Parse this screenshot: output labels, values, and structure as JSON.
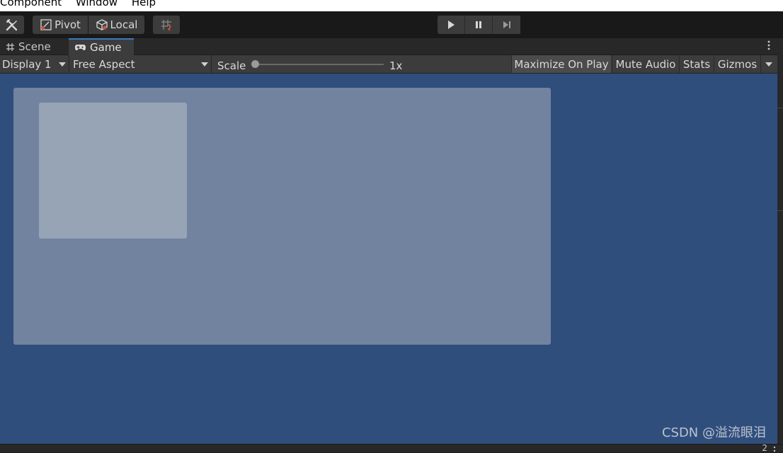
{
  "menubar": {
    "items": [
      "Component",
      "Window",
      "Help"
    ]
  },
  "toolbar": {
    "pivot_label": "Pivot",
    "local_label": "Local"
  },
  "tabs": [
    {
      "label": "Scene",
      "icon": "grid-icon",
      "active": false
    },
    {
      "label": "Game",
      "icon": "gamepad-icon",
      "active": true
    }
  ],
  "gamebar": {
    "display": "Display 1",
    "aspect": "Free Aspect",
    "scale_label": "Scale",
    "scale_value": "1x",
    "maximize": "Maximize On Play",
    "mute": "Mute Audio",
    "stats": "Stats",
    "gizmos": "Gizmos"
  },
  "watermark": "CSDN @溢流眼泪",
  "bottom_text": "2",
  "colors": {
    "accent": "#3a79bb",
    "viewport": "#304e7c",
    "panel": "#71839f",
    "inner_panel": "#97a4b6",
    "gizmo_icon": "#c8553d"
  }
}
